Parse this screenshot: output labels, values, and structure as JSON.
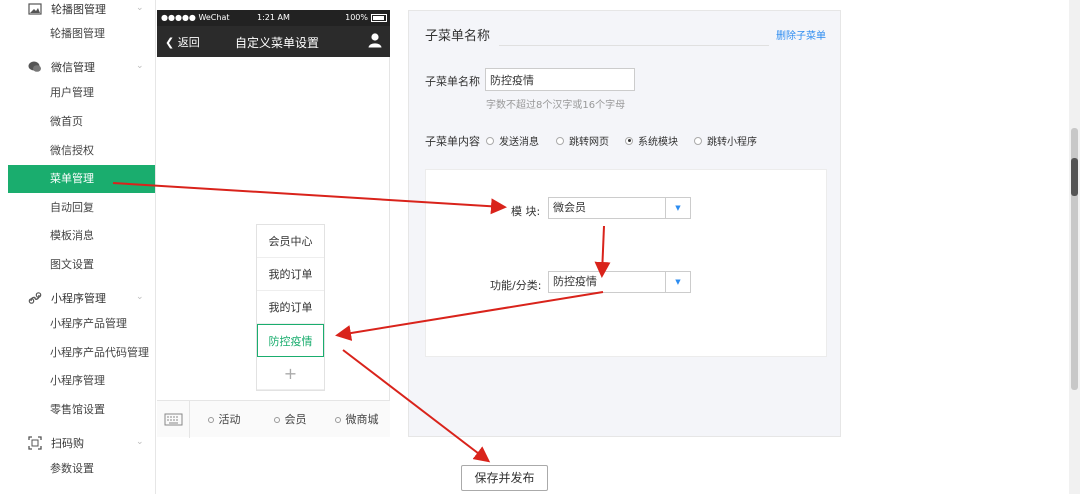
{
  "sidebar": {
    "groups": [
      {
        "label": "轮播图管理",
        "icon": "image-icon"
      },
      {
        "label": "微信管理",
        "icon": "wechat-icon"
      },
      {
        "label": "小程序管理",
        "icon": "miniprogram-icon"
      },
      {
        "label": "扫码购",
        "icon": "scan-icon"
      }
    ],
    "items": [
      {
        "label": "轮播图管理"
      },
      {
        "label": "用户管理"
      },
      {
        "label": "微首页"
      },
      {
        "label": "微信授权"
      },
      {
        "label": "菜单管理"
      },
      {
        "label": "自动回复"
      },
      {
        "label": "模板消息"
      },
      {
        "label": "图文设置"
      },
      {
        "label": "小程序产品管理"
      },
      {
        "label": "小程序产品代码管理"
      },
      {
        "label": "小程序管理"
      },
      {
        "label": "零售馆设置"
      },
      {
        "label": "参数设置"
      }
    ],
    "active_item": "菜单管理"
  },
  "phone": {
    "status_left": "●●●●● WeChat",
    "status_time": "1:21 AM",
    "status_battery": "100%",
    "back_label": "返回",
    "title": "自定义菜单设置",
    "submenu": [
      "会员中心",
      "我的订单",
      "我的订单",
      "防控疫情"
    ],
    "submenu_add": "+",
    "submenu_selected": "防控疫情",
    "tabs": [
      "活动",
      "会员",
      "微商城"
    ]
  },
  "panel": {
    "title": "子菜单名称",
    "delete_label": "删除子菜单",
    "name_label": "子菜单名称",
    "name_value": "防控疫情",
    "name_hint": "字数不超过8个汉字或16个字母",
    "content_label": "子菜单内容",
    "content_options": [
      "发送消息",
      "跳转网页",
      "系统模块",
      "跳转小程序"
    ],
    "content_selected": "系统模块",
    "module_label": "模 块:",
    "module_value": "微会员",
    "function_label": "功能/分类:",
    "function_value": "防控疫情"
  },
  "save_label": "保存并发布",
  "colors": {
    "accent_green": "#1aad6e",
    "link_blue": "#2d8cf0",
    "arrow_red": "#d9231b"
  }
}
